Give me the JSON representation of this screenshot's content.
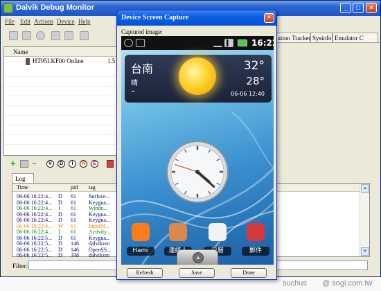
{
  "main_window": {
    "title": "Dalvik Debug Monitor",
    "menu": [
      "File",
      "Edit",
      "Actions",
      "Device",
      "Help"
    ],
    "window_buttons": {
      "minimize": "_",
      "maximize": "□",
      "close": "×"
    }
  },
  "devices": {
    "column_name": "Name",
    "rows": [
      {
        "name": "HT95LKF00 Online",
        "value": "1.5"
      }
    ]
  },
  "right_tabs": [
    "ation Tracker",
    "Sysinfo",
    "Emulator C"
  ],
  "log_toolbar": {
    "buttons": [
      "V",
      "D",
      "I",
      "W",
      "E"
    ]
  },
  "log": {
    "tab_label": "Log",
    "headers": {
      "time": "Time",
      "level": "",
      "pid": "pid",
      "tag": "tag"
    },
    "rows": [
      {
        "time": "06-06 16:22:4...",
        "level": "D",
        "pid": "61",
        "tag": "Surface...",
        "color": "#000080"
      },
      {
        "time": "06-06 16:22:4...",
        "level": "D",
        "pid": "61",
        "tag": "Keygua...",
        "color": "#000080"
      },
      {
        "time": "06-06 16:22:4...",
        "level": "I",
        "pid": "61",
        "tag": "Windo...",
        "color": "#008000"
      },
      {
        "time": "06-06 16:22:4...",
        "level": "D",
        "pid": "61",
        "tag": "Keygua...",
        "color": "#000080"
      },
      {
        "time": "06-06 16:22:4...",
        "level": "D",
        "pid": "61",
        "tag": "Keygua...",
        "color": "#000080"
      },
      {
        "time": "06-06 16:22:4...",
        "level": "W",
        "pid": "61",
        "tag": "InputM...",
        "color": "#ff8000"
      },
      {
        "time": "06-06 16:22:4...",
        "level": "I",
        "pid": "61",
        "tag": "Activity...",
        "color": "#008000"
      },
      {
        "time": "06-06 16:22:5...",
        "level": "D",
        "pid": "61",
        "tag": "Keygua...",
        "color": "#000080"
      },
      {
        "time": "06-06 16:22:5...",
        "level": "D",
        "pid": "146",
        "tag": "dalvikvm",
        "color": "#000080"
      },
      {
        "time": "06-06 16:22:5...",
        "level": "D",
        "pid": "146",
        "tag": "OpenSS...",
        "color": "#000080"
      },
      {
        "time": "06-06 16:22:5...",
        "level": "D",
        "pid": "338",
        "tag": "dalvikvm",
        "color": "#000080"
      }
    ]
  },
  "filter": {
    "label": "Filter:",
    "value": ""
  },
  "dialog": {
    "title": "Device Screen Capture",
    "captured_label": "Captured image:",
    "buttons": {
      "refresh": "Refresh",
      "save": "Save",
      "done": "Done"
    }
  },
  "phone": {
    "status_time": "16:22",
    "weather": {
      "city": "台南",
      "condition": "晴",
      "chevron": "⌄",
      "high": "32°",
      "low": "28°",
      "date": "06-06 12:40"
    },
    "apps": [
      {
        "label": "Hami",
        "icon": "hami-icon",
        "color": "#ff7a1a"
      },
      {
        "label": "連絡人",
        "icon": "contacts-icon",
        "color": "#d9894a"
      },
      {
        "label": "日曆",
        "icon": "calendar-icon",
        "color": "#f2f2f2"
      },
      {
        "label": "郵件",
        "icon": "mail-icon",
        "color": "#d33b3b"
      }
    ],
    "clock": {
      "hour": 4,
      "minute": 22,
      "second": 48
    }
  },
  "watermark": {
    "author": "suchus",
    "site": "@ sogi.com.tw"
  }
}
